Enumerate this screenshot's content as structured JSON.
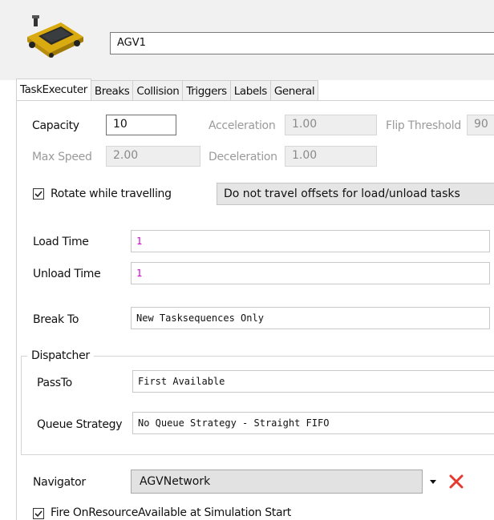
{
  "header": {
    "object_name": "AGV1",
    "thumbnail_icon": "agv-robot-icon",
    "accent_color": "#f2c418"
  },
  "tabs": [
    {
      "label": "TaskExecuter",
      "active": true
    },
    {
      "label": "Breaks",
      "active": false
    },
    {
      "label": "Collision",
      "active": false
    },
    {
      "label": "Triggers",
      "active": false
    },
    {
      "label": "Labels",
      "active": false
    },
    {
      "label": "General",
      "active": false
    }
  ],
  "motion": {
    "capacity_label": "Capacity",
    "capacity_value": "10",
    "acceleration_label": "Acceleration",
    "acceleration_value": "1.00",
    "flip_threshold_label": "Flip Threshold",
    "flip_threshold_value": "90",
    "max_speed_label": "Max Speed",
    "max_speed_value": "2.00",
    "deceleration_label": "Deceleration",
    "deceleration_value": "1.00"
  },
  "rotate": {
    "label": "Rotate while travelling",
    "checked": true
  },
  "offsets": {
    "selected": "Do not travel offsets for load/unload tasks"
  },
  "timing": {
    "load_time_label": "Load Time",
    "load_time_value": "1",
    "unload_time_label": "Unload Time",
    "unload_time_value": "1"
  },
  "break_to": {
    "label": "Break To",
    "value": "New Tasksequences Only"
  },
  "dispatcher": {
    "group_title": "Dispatcher",
    "pass_to_label": "PassTo",
    "pass_to_value": "First Available",
    "queue_strategy_label": "Queue Strategy",
    "queue_strategy_value": "No Queue Strategy - Straight FIFO"
  },
  "navigator": {
    "label": "Navigator",
    "value": "AGVNetwork",
    "delete_color": "#e53a2f"
  },
  "fire_on_resource": {
    "label": "Fire OnResourceAvailable at Simulation Start",
    "checked": true
  }
}
